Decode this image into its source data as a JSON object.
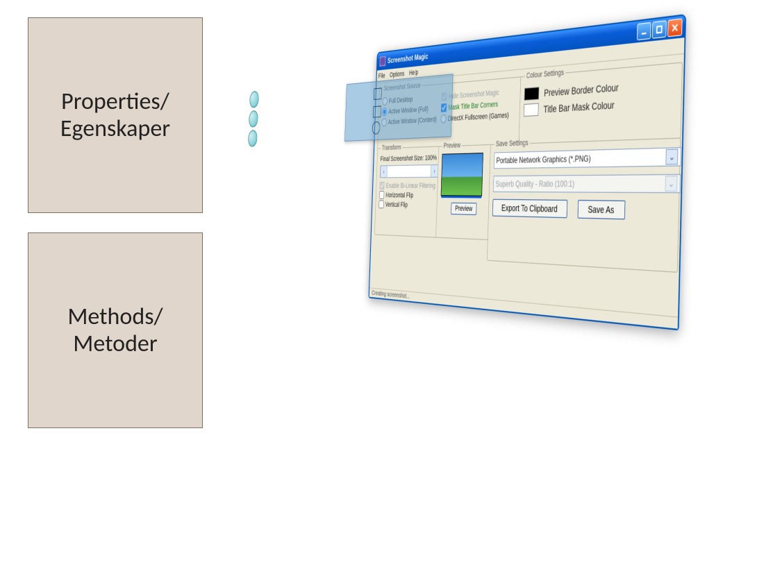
{
  "slide": {
    "properties_line1": "Properties/",
    "properties_line2": "Egenskaper",
    "methods_line1": "Methods/",
    "methods_line2": "Metoder"
  },
  "window": {
    "title": "Screenshot Magic",
    "menu": {
      "file": "File",
      "options": "Options",
      "help": "Help"
    },
    "status": "Creating screenshot..."
  },
  "source": {
    "legend": "Screenshot Source",
    "full_desktop": "Full Desktop",
    "active_full": "Active Window (Full)",
    "active_content": "Active Window (Content)",
    "hide_magic": "Hide Screenshot Magic",
    "mask_corners": "Mask Title Bar Corners",
    "directx": "DirectX Fullscreen (Games)"
  },
  "colour": {
    "legend": "Colour Settings",
    "preview_border": "Preview Border Colour",
    "titlebar_mask": "Title Bar Mask Colour",
    "preview_border_hex": "#000000",
    "titlebar_mask_hex": "#ffffff"
  },
  "transform": {
    "legend": "Transform",
    "size_label": "Final Screenshot Size: 100%",
    "bilinear": "Enable Bi-Linear Filtering",
    "hflip": "Horizontal Flip",
    "vflip": "Vertical Flip"
  },
  "preview": {
    "legend": "Preview",
    "button": "Preview"
  },
  "save": {
    "legend": "Save Settings",
    "format": "Portable Network Graphics (*.PNG)",
    "quality": "Superb Quality - Ratio (100:1)",
    "export": "Export To Clipboard",
    "save_as": "Save As"
  }
}
